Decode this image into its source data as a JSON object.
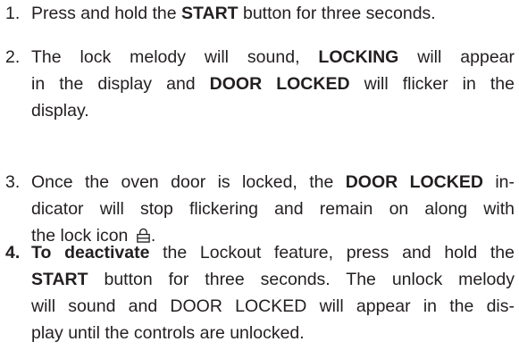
{
  "steps": [
    {
      "number": "1.",
      "lines": [
        [
          "Press and hold the ",
          {
            "b": "START"
          },
          " button for three seconds."
        ]
      ]
    },
    {
      "number": "2.",
      "lines": [
        [
          "The lock melody will sound, ",
          {
            "b": "LOCKING"
          },
          " will appear"
        ],
        [
          "in the display and ",
          {
            "b": "DOOR LOCKED"
          },
          " will flicker in the"
        ],
        [
          "display."
        ]
      ]
    },
    {
      "number": "3.",
      "lines": [
        [
          "Once the oven door is locked, the ",
          {
            "b": "DOOR LOCKED"
          },
          " in-"
        ],
        [
          "dicator will stop flickering and remain on along with"
        ],
        [
          "the lock icon ",
          {
            "icon": "lock-icon"
          },
          "."
        ]
      ]
    },
    {
      "number": "4.",
      "number_bold": true,
      "lines": [
        [
          {
            "b": "To deactivate"
          },
          " the Lockout feature, press and hold the"
        ],
        [
          {
            "b": "START"
          },
          " button for three seconds. The unlock melody"
        ],
        [
          "will sound and DOOR LOCKED will appear in the dis-"
        ],
        [
          "play until the controls are unlocked."
        ]
      ]
    }
  ]
}
